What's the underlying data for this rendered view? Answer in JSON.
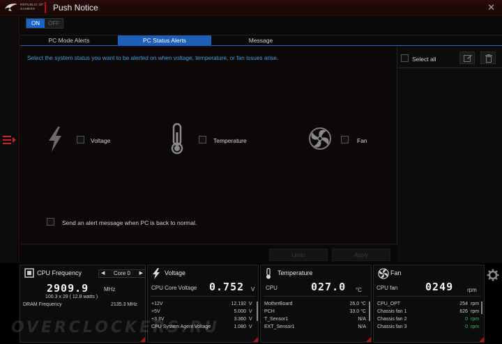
{
  "window": {
    "brand_line1": "REPUBLIC OF",
    "brand_line2": "GAMERS",
    "title": "Push Notice"
  },
  "toggle": {
    "on": "ON",
    "off": "OFF",
    "selected": "ON"
  },
  "tabs": [
    {
      "label": "PC Mode Alerts",
      "active": false
    },
    {
      "label": "PC Status Alerts",
      "active": true
    },
    {
      "label": "Message",
      "active": false
    }
  ],
  "content": {
    "description": "Select the system status you want to be alerted on when voltage, temperature, or fan issues arise.",
    "options": [
      {
        "label": "Voltage",
        "icon": "lightning-icon",
        "checked": false
      },
      {
        "label": "Temperature",
        "icon": "thermometer-icon",
        "checked": false
      },
      {
        "label": "Fan",
        "icon": "fan-icon",
        "checked": false
      }
    ],
    "normal_alert": "Send an alert message when PC is back to normal.",
    "undo": "Undo",
    "apply": "Apply"
  },
  "right_panel": {
    "select_all": "Select all",
    "icons": [
      "edit-icon",
      "trash-icon"
    ]
  },
  "widgets": {
    "cpu": {
      "title": "CPU Frequency",
      "core": "Core 0",
      "freq_value": "2909.9",
      "freq_unit": "MHz",
      "detail": "100.3  x  29  ( 12.8    watts )",
      "dram_label": "DRAM Frequency",
      "dram_value": "2135.3  MHz"
    },
    "voltage": {
      "title": "Voltage",
      "main_label": "CPU Core Voltage",
      "main_value": "0.752",
      "main_unit": "V",
      "rows": [
        {
          "name": "+12V",
          "value": "12.192",
          "unit": "V"
        },
        {
          "name": "+5V",
          "value": "5.000",
          "unit": "V"
        },
        {
          "name": "+3.3V",
          "value": "3.360",
          "unit": "V"
        },
        {
          "name": "CPU System Agent Voltage",
          "value": "1.080",
          "unit": "V"
        }
      ]
    },
    "temperature": {
      "title": "Temperature",
      "main_label": "CPU",
      "main_value": "027.0",
      "main_unit": "°C",
      "rows": [
        {
          "name": "MotherBoard",
          "value": "26.0 °C"
        },
        {
          "name": "PCH",
          "value": "33.0 °C"
        },
        {
          "name": "T_Sensor1",
          "value": "N/A"
        },
        {
          "name": "EXT_Sensor1",
          "value": "N/A"
        }
      ]
    },
    "fan": {
      "title": "Fan",
      "main_label": "CPU fan",
      "main_value": "0249",
      "main_unit": "rpm",
      "rows": [
        {
          "name": "CPU_OPT",
          "value": "254",
          "unit": "rpm",
          "zero": false
        },
        {
          "name": "Chassis fan 1",
          "value": "626",
          "unit": "rpm",
          "zero": false
        },
        {
          "name": "Chassis fan 2",
          "value": "0",
          "unit": "rpm",
          "zero": true
        },
        {
          "name": "Chassis fan 3",
          "value": "0",
          "unit": "rpm",
          "zero": true
        }
      ]
    }
  },
  "watermark": "OVERCLOCKERS.RU",
  "colors": {
    "accent_red": "#b01018",
    "accent_blue": "#1d5fb8",
    "info_text": "#3fa3e6",
    "ok_green": "#3fbf5f"
  }
}
